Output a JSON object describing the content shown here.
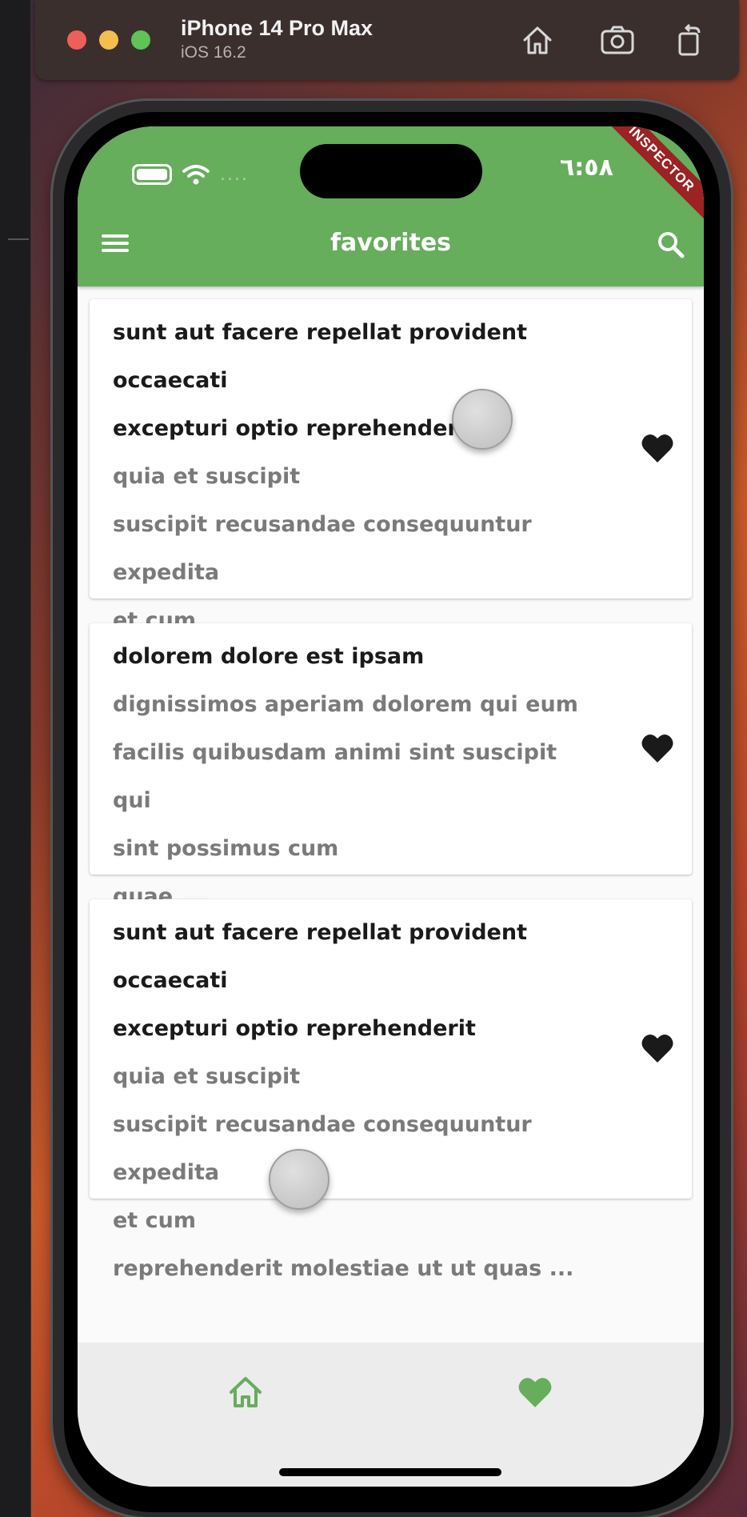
{
  "simulator": {
    "device_name": "iPhone 14 Pro Max",
    "os_version": "iOS 16.2"
  },
  "status_bar": {
    "time": "٦:٥٨",
    "signal": "...."
  },
  "debug_banner": "INSPECTOR",
  "app_bar": {
    "title": "favorites"
  },
  "posts": [
    {
      "title": "sunt aut facere repellat provident occaecati\nexcepturi optio reprehenderit",
      "body": "quia et suscipit\nsuscipit recusandae consequuntur expedita\net cum\nreprehenderit molestiae ut ut quas ...",
      "favorite": true
    },
    {
      "title": "dolorem dolore est ipsam",
      "body": "dignissimos aperiam dolorem qui eum\nfacilis quibusdam animi sint suscipit qui\nsint possimus cum\nquae ...",
      "favorite": true
    },
    {
      "title": "sunt aut facere repellat provident occaecati\nexcepturi optio reprehenderit",
      "body": "quia et suscipit\nsuscipit recusandae consequuntur expedita\net cum\nreprehenderit molestiae ut ut quas ...",
      "favorite": true
    }
  ],
  "bottom_nav": {
    "items": [
      {
        "icon": "home-icon",
        "active": false
      },
      {
        "icon": "heart-icon",
        "active": true
      }
    ]
  },
  "colors": {
    "primary": "#66ad5c",
    "card_title": "#1a1a1a",
    "card_body": "#7a7a7a",
    "heart": "#1a1a1a",
    "nav_active": "#66ad5c",
    "banner": "#9b2323"
  }
}
